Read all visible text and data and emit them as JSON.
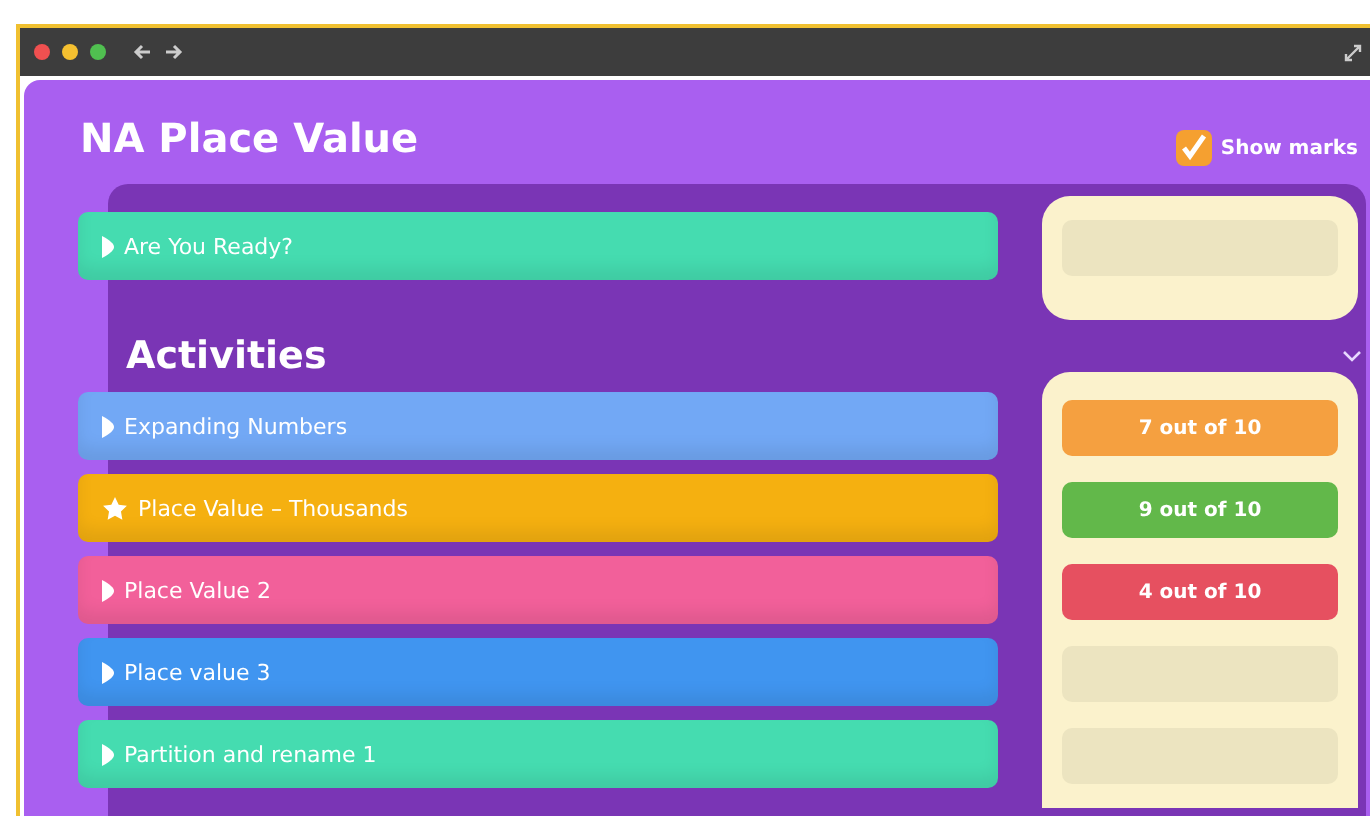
{
  "title": "NA Place Value",
  "show_marks": {
    "label": "Show marks",
    "checked": true
  },
  "intro": {
    "label": "Are You Ready?",
    "kind": "arrow",
    "color": "#45dcb0"
  },
  "section": {
    "title": "Activities",
    "expanded": true
  },
  "activities": [
    {
      "label": "Expanding Numbers",
      "kind": "arrow",
      "color": "#72a8f5",
      "score": {
        "text": "7 out of 10",
        "color": "#f5a040"
      }
    },
    {
      "label": "Place Value – Thousands",
      "kind": "star",
      "color": "#f5b010",
      "score": {
        "text": "9 out of 10",
        "color": "#62b84a"
      }
    },
    {
      "label": "Place Value 2",
      "kind": "arrow",
      "color": "#f2609a",
      "score": {
        "text": "4 out of 10",
        "color": "#e65060"
      }
    },
    {
      "label": "Place value 3",
      "kind": "arrow",
      "color": "#4095f0"
    },
    {
      "label": "Partition and rename 1",
      "kind": "arrow",
      "color": "#45dcb0"
    }
  ]
}
